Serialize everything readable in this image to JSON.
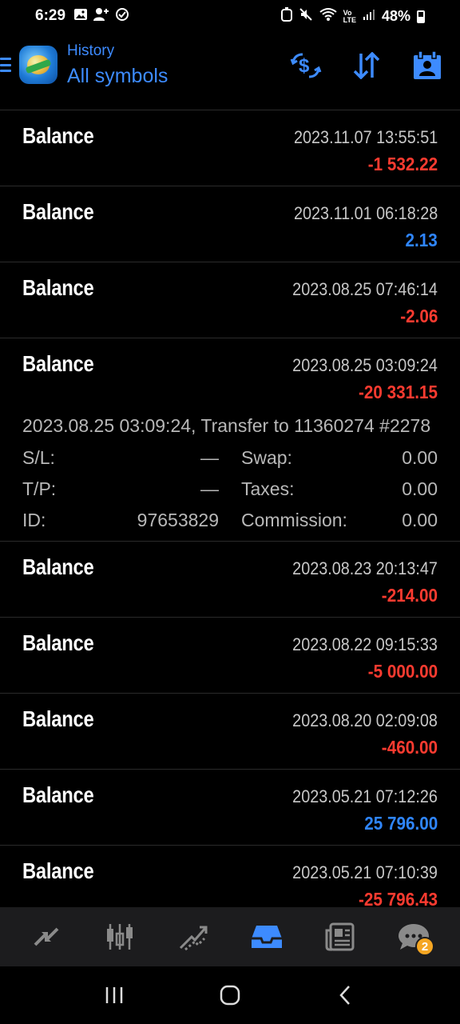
{
  "status_bar": {
    "time": "6:29",
    "battery": "48%"
  },
  "header": {
    "subtitle": "History",
    "title": "All symbols"
  },
  "rows": [
    {
      "type": "Balance",
      "time": "2023.11.07 13:55:51",
      "amount": "-1 532.22",
      "sign": "neg"
    },
    {
      "type": "Balance",
      "time": "2023.11.01 06:18:28",
      "amount": "2.13",
      "sign": "pos"
    },
    {
      "type": "Balance",
      "time": "2023.08.25 07:46:14",
      "amount": "-2.06",
      "sign": "neg"
    },
    {
      "type": "Balance",
      "time": "2023.08.25 03:09:24",
      "amount": "-20 331.15",
      "sign": "neg"
    },
    {
      "type": "Balance",
      "time": "2023.08.23 20:13:47",
      "amount": "-214.00",
      "sign": "neg"
    },
    {
      "type": "Balance",
      "time": "2023.08.22 09:15:33",
      "amount": "-5 000.00",
      "sign": "neg"
    },
    {
      "type": "Balance",
      "time": "2023.08.20 02:09:08",
      "amount": "-460.00",
      "sign": "neg"
    },
    {
      "type": "Balance",
      "time": "2023.05.21 07:12:26",
      "amount": "25 796.00",
      "sign": "pos"
    },
    {
      "type": "Balance",
      "time": "2023.05.21 07:10:39",
      "amount": "-25 796.43",
      "sign": "neg"
    }
  ],
  "expanded_detail": {
    "comment": "2023.08.25 03:09:24, Transfer to 11360274 #2278",
    "sl_label": "S/L:",
    "sl_value": "—",
    "tp_label": "T/P:",
    "tp_value": "—",
    "id_label": "ID:",
    "id_value": "97653829",
    "swap_label": "Swap:",
    "swap_value": "0.00",
    "taxes_label": "Taxes:",
    "taxes_value": "0.00",
    "commission_label": "Commission:",
    "commission_value": "0.00"
  },
  "bottom_nav": {
    "items": [
      {
        "name": "quotes",
        "icon": "arrows-diagonal-icon"
      },
      {
        "name": "chart",
        "icon": "candlesticks-icon"
      },
      {
        "name": "trade",
        "icon": "trend-icon"
      },
      {
        "name": "history",
        "icon": "inbox-icon",
        "active": true
      },
      {
        "name": "news",
        "icon": "newspaper-icon"
      },
      {
        "name": "messages",
        "icon": "chat-icon",
        "badge": "2"
      }
    ]
  },
  "colors": {
    "accent": "#3d8bff",
    "negative": "#ff3b30",
    "positive": "#2f86ff",
    "badge": "#f5a623"
  }
}
